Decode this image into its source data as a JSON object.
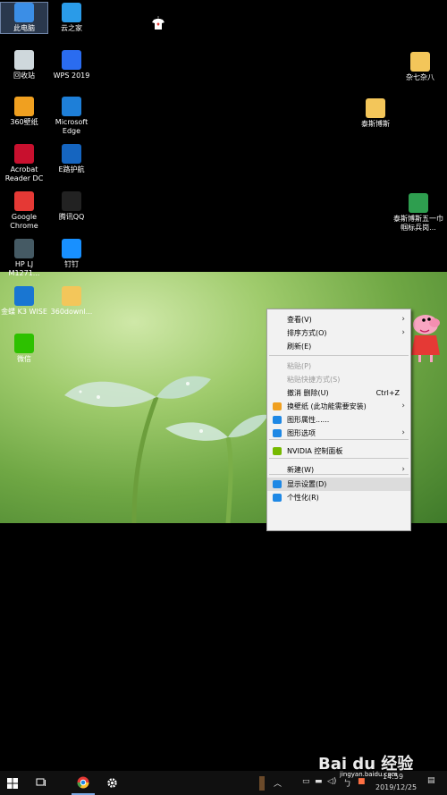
{
  "desktop": {
    "left_icons": [
      {
        "label": "此电脑",
        "icon": "computer-icon",
        "color": "#3b8ee6"
      },
      {
        "label": "云之家",
        "icon": "cloud-icon",
        "color": "#2a9be8"
      },
      {
        "label": "回收站",
        "icon": "recycle-bin-icon",
        "color": "#cfd8dc"
      },
      {
        "label": "WPS 2019",
        "icon": "wps-icon",
        "color": "#2a6cf0"
      },
      {
        "label": "360壁纸",
        "icon": "360-wallpaper-icon",
        "color": "#f0a020"
      },
      {
        "label": "Microsoft Edge",
        "icon": "edge-icon",
        "color": "#1e7fd8"
      },
      {
        "label": "Acrobat Reader DC",
        "icon": "acrobat-icon",
        "color": "#c8102e"
      },
      {
        "label": "E路护航",
        "icon": "e-escort-icon",
        "color": "#1565c0"
      },
      {
        "label": "Google Chrome",
        "icon": "chrome-icon",
        "color": "#e53935"
      },
      {
        "label": "腾讯QQ",
        "icon": "qq-icon",
        "color": "#222222"
      },
      {
        "label": "HP LJ M1271...",
        "icon": "printer-icon",
        "color": "#455a64"
      },
      {
        "label": "钉钉",
        "icon": "dingtalk-icon",
        "color": "#1890ff"
      },
      {
        "label": "金蝶 K3 WISE",
        "icon": "kingdee-icon",
        "color": "#1976d2"
      },
      {
        "label": "360downl...",
        "icon": "folder-icon",
        "color": "#f3c65a"
      },
      {
        "label": "微信",
        "icon": "wechat-icon",
        "color": "#2dc100"
      }
    ],
    "right_icons": [
      {
        "label": "杂七杂八",
        "icon": "folder-icon",
        "color": "#f3c65a"
      },
      {
        "label": "泰斯博斯",
        "icon": "folder-icon",
        "color": "#f3c65a"
      },
      {
        "label": "泰斯博斯五一巾帼标兵岗...",
        "icon": "spreadsheet-icon",
        "color": "#2e9e4f"
      }
    ]
  },
  "context_menu": {
    "items": [
      {
        "label": "查看(V)",
        "submenu": true
      },
      {
        "label": "排序方式(O)",
        "submenu": true
      },
      {
        "label": "刷新(E)"
      },
      {
        "label": "粘贴(P)",
        "disabled": true
      },
      {
        "label": "粘贴快捷方式(S)",
        "disabled": true
      },
      {
        "label": "撤消 删除(U)",
        "shortcut": "Ctrl+Z"
      },
      {
        "label": "换壁纸 (此功能需要安装)",
        "submenu": true,
        "icon": "wallpaper-icon"
      },
      {
        "label": "图形属性......",
        "icon": "intel-graphics-icon"
      },
      {
        "label": "图形选项",
        "submenu": true,
        "icon": "intel-graphics-icon"
      },
      {
        "label": "NVIDIA 控制面板",
        "icon": "nvidia-icon"
      },
      {
        "label": "新建(W)",
        "submenu": true
      },
      {
        "label": "显示设置(D)",
        "icon": "display-icon",
        "hover": true
      },
      {
        "label": "个性化(R)",
        "icon": "personalize-icon"
      }
    ]
  },
  "taskbar": {
    "clock_date": "2019/12/25",
    "clock_time": "14:59",
    "watermark": "Bai du 经验",
    "watermark_url": "jingyan.baidu.com"
  }
}
